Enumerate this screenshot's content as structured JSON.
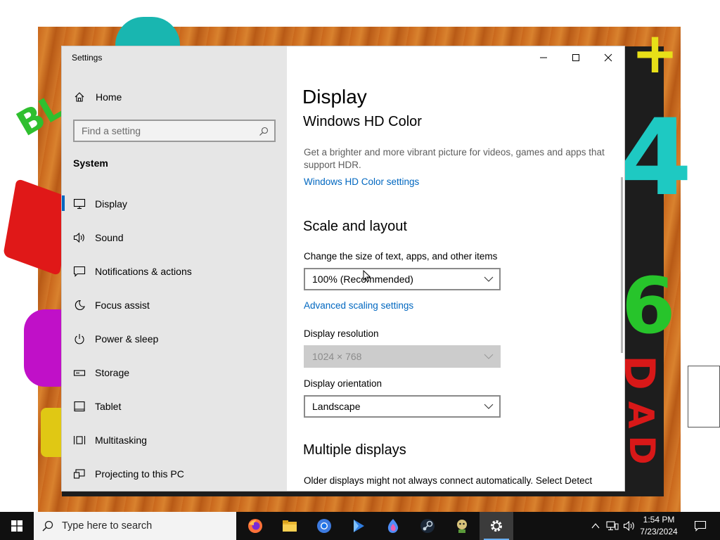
{
  "window": {
    "title": "Settings",
    "caption": {
      "minimize": "minimize-icon",
      "maximize": "maximize-icon",
      "close": "close-icon"
    }
  },
  "sidebar": {
    "home_label": "Home",
    "search_placeholder": "Find a setting",
    "section": "System",
    "items": [
      {
        "label": "Display",
        "icon": "display-icon",
        "active": true
      },
      {
        "label": "Sound",
        "icon": "speaker-icon",
        "active": false
      },
      {
        "label": "Notifications & actions",
        "icon": "notification-icon",
        "active": false
      },
      {
        "label": "Focus assist",
        "icon": "moon-icon",
        "active": false
      },
      {
        "label": "Power & sleep",
        "icon": "power-icon",
        "active": false
      },
      {
        "label": "Storage",
        "icon": "storage-icon",
        "active": false
      },
      {
        "label": "Tablet",
        "icon": "tablet-icon",
        "active": false
      },
      {
        "label": "Multitasking",
        "icon": "multitasking-icon",
        "active": false
      },
      {
        "label": "Projecting to this PC",
        "icon": "projecting-icon",
        "active": false
      }
    ]
  },
  "main": {
    "title": "Display",
    "hd_color": {
      "heading": "Windows HD Color",
      "description": "Get a brighter and more vibrant picture for videos, games and apps that support HDR.",
      "link": "Windows HD Color settings"
    },
    "scale": {
      "heading": "Scale and layout",
      "size_label": "Change the size of text, apps, and other items",
      "size_value": "100% (Recommended)",
      "advanced_link": "Advanced scaling settings",
      "resolution_label": "Display resolution",
      "resolution_value": "1024 × 768",
      "orientation_label": "Display orientation",
      "orientation_value": "Landscape"
    },
    "multiple": {
      "heading": "Multiple displays",
      "description": "Older displays might not always connect automatically. Select Detect"
    }
  },
  "taskbar": {
    "search_placeholder": "Type here to search",
    "apps": [
      "firefox-icon",
      "file-explorer-icon",
      "chrome-icon",
      "media-player-icon",
      "edge-dev-icon",
      "steam-icon",
      "game-icon",
      "settings-icon"
    ],
    "clock": {
      "time": "1:54 PM",
      "date": "7/23/2024"
    }
  },
  "colors": {
    "accent": "#0067c0",
    "sidebar_bg": "#e6e6e6",
    "taskbar_bg": "#101010"
  }
}
